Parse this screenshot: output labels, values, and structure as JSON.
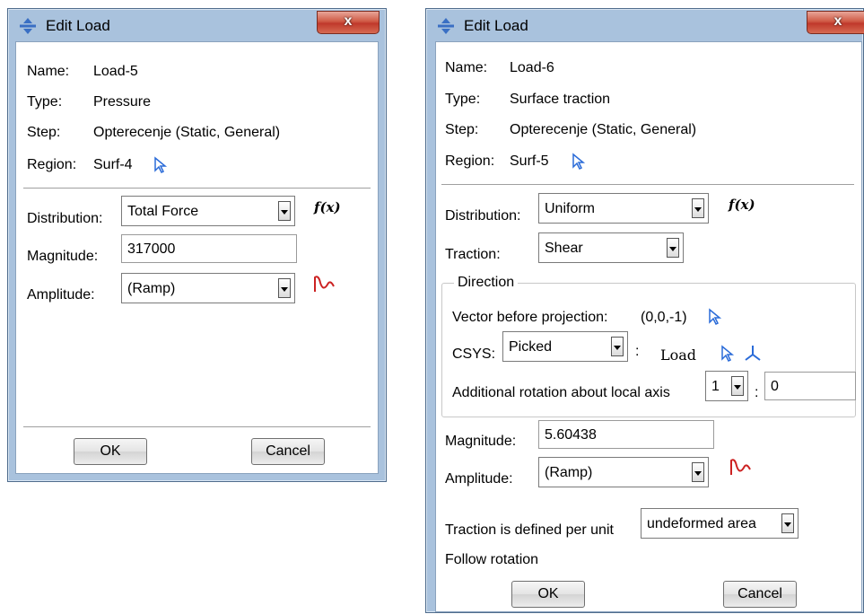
{
  "dialog1": {
    "title": "Edit Load",
    "close": "x",
    "name_label": "Name:",
    "name_value": "Load-5",
    "type_label": "Type:",
    "type_value": "Pressure",
    "step_label": "Step:",
    "step_value": "Opterecenje (Static, General)",
    "region_label": "Region:",
    "region_value": "Surf-4",
    "distribution_label": "Distribution:",
    "distribution_value": "Total Force",
    "fx": "f(x)",
    "magnitude_label": "Magnitude:",
    "magnitude_value": "317000",
    "amplitude_label": "Amplitude:",
    "amplitude_value": "(Ramp)",
    "ok": "OK",
    "cancel": "Cancel"
  },
  "dialog2": {
    "title": "Edit Load",
    "close": "x",
    "name_label": "Name:",
    "name_value": "Load-6",
    "type_label": "Type:",
    "type_value": "Surface traction",
    "step_label": "Step:",
    "step_value": "Opterecenje (Static, General)",
    "region_label": "Region:",
    "region_value": "Surf-5",
    "distribution_label": "Distribution:",
    "distribution_value": "Uniform",
    "fx": "f(x)",
    "traction_label": "Traction:",
    "traction_value": "Shear",
    "direction_title": "Direction",
    "vector_label": "Vector before projection:",
    "vector_value": "(0,0,-1)",
    "csys_label": "CSYS:",
    "csys_value": "Picked",
    "csys_colon": ":",
    "csys_load": "Load",
    "rotation_label": "Additional rotation about local axis",
    "rotation_axis": "1",
    "rotation_colon": ":",
    "rotation_value": "0",
    "magnitude_label": "Magnitude:",
    "magnitude_value": "5.60438",
    "amplitude_label": "Amplitude:",
    "amplitude_value": "(Ramp)",
    "per_unit_label": "Traction is defined per unit",
    "per_unit_value": "undeformed area",
    "follow_rotation": "Follow rotation",
    "ok": "OK",
    "cancel": "Cancel"
  },
  "colors": {
    "frame": "#a9c2dd",
    "close": "#c0392b",
    "pointer": "#2a6bd8",
    "amplitude_icon": "#cc2222"
  }
}
